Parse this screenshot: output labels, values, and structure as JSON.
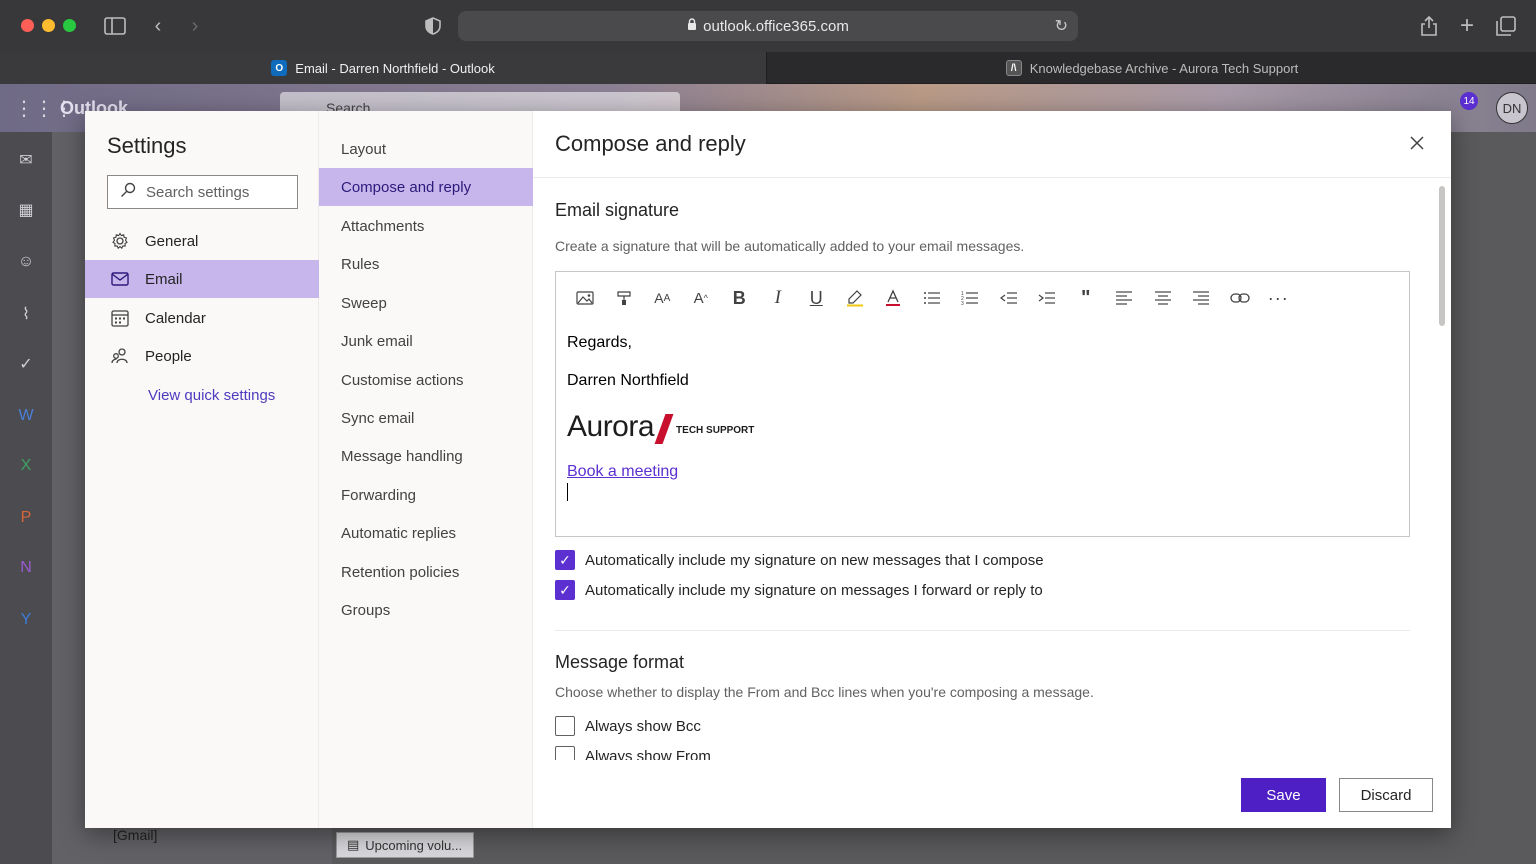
{
  "browser": {
    "address": "outlook.office365.com",
    "tabs": [
      {
        "label": "Email - Darren Northfield - Outlook",
        "active": true
      },
      {
        "label": "Knowledgebase Archive - Aurora Tech Support",
        "active": false
      }
    ]
  },
  "outlook_bg": {
    "app_name": "Outlook",
    "search_placeholder": "Search",
    "avatar_initials": "DN",
    "notification_count": "14",
    "folder_gmail": "[Gmail]",
    "chip_label": "Upcoming volu..."
  },
  "settings": {
    "title": "Settings",
    "search_placeholder": "Search settings",
    "nav": [
      {
        "label": "General",
        "icon": "gear-icon"
      },
      {
        "label": "Email",
        "icon": "mail-icon"
      },
      {
        "label": "Calendar",
        "icon": "calendar-icon"
      },
      {
        "label": "People",
        "icon": "people-icon"
      }
    ],
    "quick_settings_link": "View quick settings",
    "email_sub": [
      "Layout",
      "Compose and reply",
      "Attachments",
      "Rules",
      "Sweep",
      "Junk email",
      "Customise actions",
      "Sync email",
      "Message handling",
      "Forwarding",
      "Automatic replies",
      "Retention policies",
      "Groups"
    ]
  },
  "compose": {
    "title": "Compose and reply",
    "signature": {
      "title": "Email signature",
      "description": "Create a signature that will be automatically added to your email messages.",
      "lines": [
        "Regards,",
        "Darren Northfield"
      ],
      "logo_word": "Aurora",
      "logo_sub": "TECH SUPPORT",
      "link": "Book a meeting",
      "options": [
        {
          "label": "Automatically include my signature on new messages that I compose",
          "checked": true
        },
        {
          "label": "Automatically include my signature on messages I forward or reply to",
          "checked": true
        }
      ]
    },
    "message_format": {
      "title": "Message format",
      "description": "Choose whether to display the From and Bcc lines when you're composing a message.",
      "options": [
        {
          "label": "Always show Bcc",
          "checked": false
        },
        {
          "label": "Always show From",
          "checked": false
        }
      ]
    },
    "buttons": {
      "save": "Save",
      "discard": "Discard"
    }
  },
  "colors": {
    "accent": "#5b2fd0",
    "selected_bg": "#c7b6ec",
    "save_button": "#4f1fc6"
  }
}
